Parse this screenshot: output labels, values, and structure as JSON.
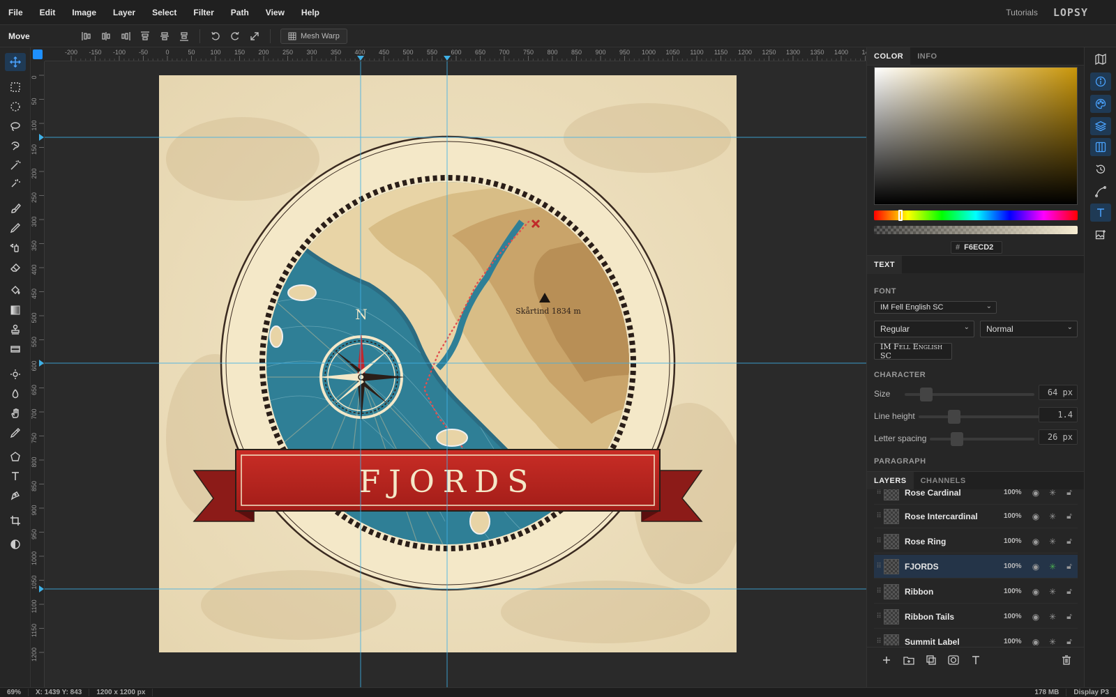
{
  "menubar": {
    "items": [
      "File",
      "Edit",
      "Image",
      "Layer",
      "Select",
      "Filter",
      "Path",
      "View",
      "Help"
    ],
    "tutorials": "Tutorials",
    "logo": "LOPSY"
  },
  "toolbar": {
    "tool_name": "Move",
    "mesh_warp": "Mesh Warp"
  },
  "ruler": {
    "top_ticks": [
      "-200",
      "-150",
      "-100",
      "-50",
      "0",
      "50",
      "100",
      "150",
      "200",
      "250",
      "300",
      "350",
      "400",
      "450",
      "500",
      "550",
      "600",
      "650",
      "700",
      "750",
      "800",
      "850",
      "900",
      "950",
      "1000",
      "1050",
      "1100",
      "1150",
      "1200",
      "1250",
      "1300",
      "1350",
      "1400",
      "14"
    ],
    "left_ticks": [
      "0",
      "50",
      "100",
      "150",
      "200",
      "250",
      "300",
      "350",
      "400",
      "450",
      "500",
      "550",
      "600",
      "650",
      "700",
      "750",
      "800",
      "850",
      "900",
      "950",
      "1000",
      "1050",
      "1100",
      "1150",
      "1200"
    ]
  },
  "artwork": {
    "title": "FJORDS",
    "north": "N",
    "summit_label": "Skårtind 1834 m"
  },
  "panel": {
    "color_tabs": [
      "COLOR",
      "INFO"
    ],
    "hex_prefix": "#",
    "hex": "F6ECD2",
    "text_tab": "TEXT",
    "font_label": "FONT",
    "font_family": "IM Fell English SC",
    "font_style": "Regular",
    "font_weight": "Normal",
    "font_preview": "IM Fell English SC",
    "character_label": "CHARACTER",
    "size_label": "Size",
    "size_value": "64 px",
    "lineheight_label": "Line height",
    "lineheight_value": "1.4",
    "letterspacing_label": "Letter spacing",
    "letterspacing_value": "26 px",
    "paragraph_label": "PARAGRAPH",
    "layer_tabs": [
      "LAYERS",
      "CHANNELS"
    ],
    "layers": [
      {
        "name": "Rose Cardinal",
        "opacity": "100%"
      },
      {
        "name": "Rose Intercardinal",
        "opacity": "100%"
      },
      {
        "name": "Rose Ring",
        "opacity": "100%"
      },
      {
        "name": "FJORDS",
        "opacity": "100%"
      },
      {
        "name": "Ribbon",
        "opacity": "100%"
      },
      {
        "name": "Ribbon Tails",
        "opacity": "100%"
      },
      {
        "name": "Summit Label",
        "opacity": "100%"
      }
    ]
  },
  "status": {
    "zoom": "69%",
    "coords": "X: 1439 Y: 843",
    "docsize": "1200 x 1200 px",
    "memory": "178 MB",
    "colorspace": "Display P3"
  },
  "colors": {
    "accent": "#1e90ff",
    "ribbon": "#b8231f",
    "sea": "#2f7f96",
    "land": "#c9a46a",
    "paper": "#f6ecd2"
  }
}
